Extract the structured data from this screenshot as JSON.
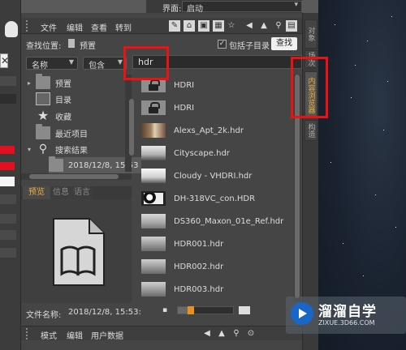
{
  "top_bar": {
    "interface_label": "界面:",
    "interface_value": "启动"
  },
  "menubar": {
    "items": [
      "文件",
      "编辑",
      "查看",
      "转到"
    ]
  },
  "search_row": {
    "location_label": "查找位置:",
    "location_value": "预置",
    "include_subdirs_label": "包括子目录",
    "find_button": "查找"
  },
  "filter_row": {
    "field_select": "名称",
    "mode_select": "包含",
    "search_value": "hdr"
  },
  "tree": {
    "items": [
      {
        "label": "预置",
        "icon": "folder-icon"
      },
      {
        "label": "目录",
        "icon": "catalog-icon"
      },
      {
        "label": "收藏",
        "icon": "star-icon"
      },
      {
        "label": "最近项目",
        "icon": "folder-icon"
      },
      {
        "label": "搜索结果",
        "icon": "magnifier-icon"
      },
      {
        "label": "2018/12/8, 15:53",
        "icon": "folder-icon"
      }
    ]
  },
  "preview_tabs": [
    "预览",
    "信息",
    "语言"
  ],
  "preview": {
    "file_name_label": "文件名称:",
    "file_name_value": "2018/12/8, 15:53:"
  },
  "file_list": [
    {
      "name": "HDRI",
      "thumb": "lock"
    },
    {
      "name": "HDRI",
      "thumb": "lock"
    },
    {
      "name": "Alexs_Apt_2k.hdr",
      "thumb": "room"
    },
    {
      "name": "Cityscape.hdr",
      "thumb": "city"
    },
    {
      "name": "Cloudy - VHDRI.hdr",
      "thumb": "cloud"
    },
    {
      "name": "DH-318VC_con.HDR",
      "thumb": "dh"
    },
    {
      "name": "DS360_Maxon_01e_Ref.hdr",
      "thumb": "ds"
    },
    {
      "name": "HDR001.hdr",
      "thumb": "sky"
    },
    {
      "name": "HDR002.hdr",
      "thumb": "sky"
    },
    {
      "name": "HDR003.hdr",
      "thumb": "sky"
    }
  ],
  "bottom_bar": {
    "items": [
      "模式",
      "编辑",
      "用户数据"
    ]
  },
  "right_tabs": [
    "对象",
    "场次",
    "内容浏览器",
    "构造"
  ],
  "thumbnail_size": 0.2,
  "watermark": {
    "title": "溜溜自学",
    "url": "ZIXUE.3D66.COM"
  },
  "colors": {
    "accent": "#f0b040",
    "annotation": "#ee1111",
    "watermark_blue": "#1a66c8"
  }
}
